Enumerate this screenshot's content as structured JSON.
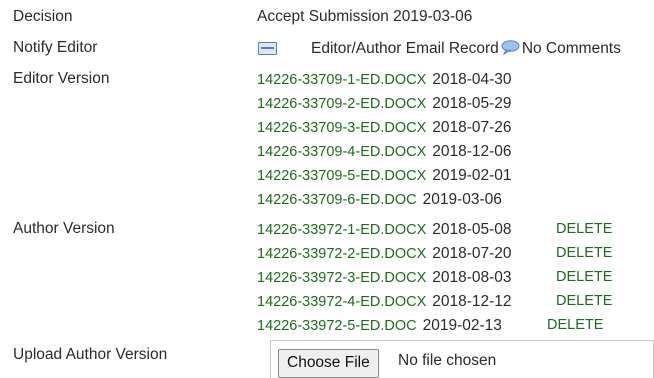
{
  "decision": {
    "label": "Decision",
    "value": "Accept Submission 2019-03-06"
  },
  "notify": {
    "label": "Notify Editor",
    "email_record": "Editor/Author Email Record",
    "comments": "No Comments",
    "icons": [
      "envelope-icon",
      "comment-bubble-icon"
    ]
  },
  "editor_versions": {
    "label": "Editor Version",
    "files": [
      {
        "name": "14226-33709-1-ED.DOCX",
        "date": "2018-04-30"
      },
      {
        "name": "14226-33709-2-ED.DOCX",
        "date": "2018-05-29"
      },
      {
        "name": "14226-33709-3-ED.DOCX",
        "date": "2018-07-26"
      },
      {
        "name": "14226-33709-4-ED.DOCX",
        "date": "2018-12-06"
      },
      {
        "name": "14226-33709-5-ED.DOCX",
        "date": "2019-02-01"
      },
      {
        "name": "14226-33709-6-ED.DOC",
        "date": "2019-03-06"
      }
    ]
  },
  "author_versions": {
    "label": "Author Version",
    "delete_label": "DELETE",
    "files": [
      {
        "name": "14226-33972-1-ED.DOCX",
        "date": "2018-05-08"
      },
      {
        "name": "14226-33972-2-ED.DOCX",
        "date": "2018-07-20"
      },
      {
        "name": "14226-33972-3-ED.DOCX",
        "date": "2018-08-03"
      },
      {
        "name": "14226-33972-4-ED.DOCX",
        "date": "2018-12-12"
      },
      {
        "name": "14226-33972-5-ED.DOC",
        "date": "2019-02-13"
      }
    ]
  },
  "upload": {
    "label": "Upload Author Version",
    "button": "Choose File",
    "status": "No file chosen"
  },
  "colors": {
    "link": "#1e6b1e",
    "text": "#2b2b2b"
  }
}
